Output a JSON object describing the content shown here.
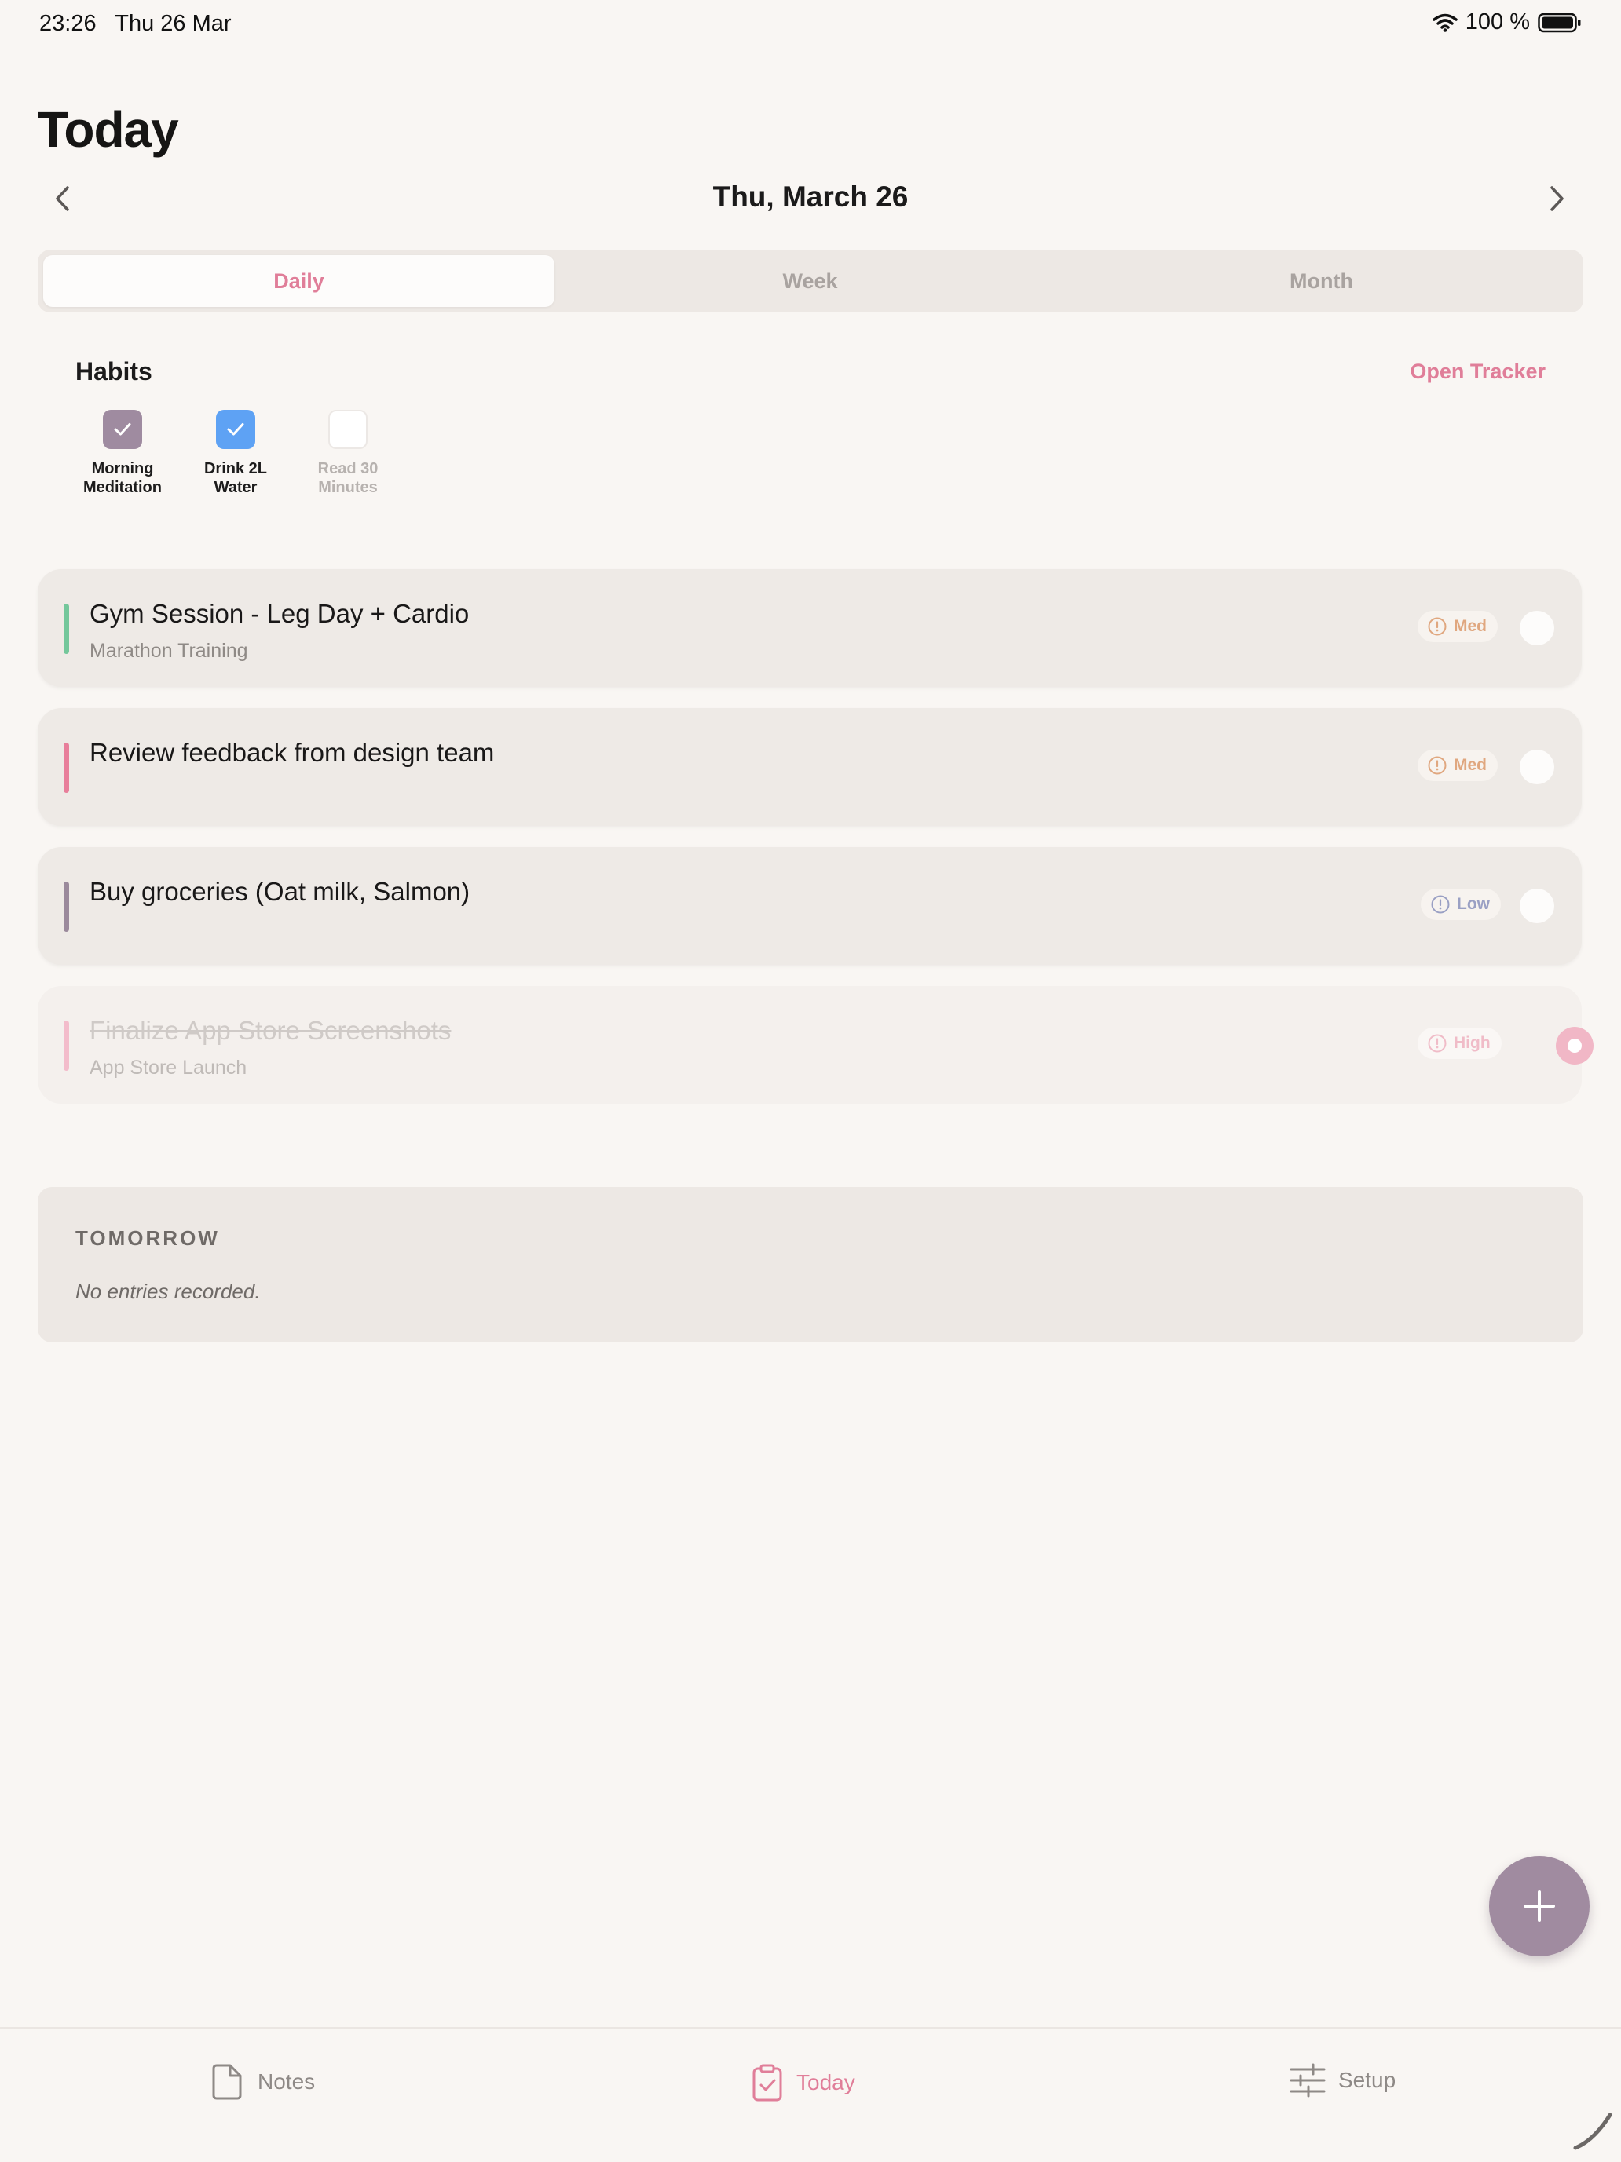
{
  "status_bar": {
    "time": "23:26",
    "date": "Thu 26 Mar",
    "battery": "100 %"
  },
  "page": {
    "title": "Today",
    "date": "Thu, March 26"
  },
  "segments": [
    {
      "label": "Daily",
      "active": true
    },
    {
      "label": "Week",
      "active": false
    },
    {
      "label": "Month",
      "active": false
    }
  ],
  "habits": {
    "title": "Habits",
    "open_tracker": "Open Tracker",
    "items": [
      {
        "line1": "Morning",
        "line2": "Meditation",
        "done": true,
        "color": "#9f8ba0"
      },
      {
        "line1": "Drink 2L",
        "line2": "Water",
        "done": true,
        "color": "#5ea2f4"
      },
      {
        "line1": "Read 30",
        "line2": "Minutes",
        "done": false,
        "color": "#ffffff"
      }
    ]
  },
  "tasks": [
    {
      "title": "Gym Session - Leg Day + Cardio",
      "subtitle": "Marathon Training",
      "priority": "Med",
      "bar_color": "#74c79b",
      "priority_color": "#e0a77f",
      "done": false
    },
    {
      "title": "Review feedback from design team",
      "subtitle": "",
      "priority": "Med",
      "bar_color": "#e87f9b",
      "priority_color": "#e0a77f",
      "done": false
    },
    {
      "title": "Buy groceries (Oat milk, Salmon)",
      "subtitle": "",
      "priority": "Low",
      "bar_color": "#9b8a9c",
      "priority_color": "#9aa0c4",
      "done": false
    },
    {
      "title": "Finalize App Store Screenshots",
      "subtitle": "App Store Launch",
      "priority": "High",
      "bar_color": "#f3bccb",
      "priority_color": "#f0bcc8",
      "done": true
    }
  ],
  "tomorrow": {
    "title": "TOMORROW",
    "empty": "No entries recorded."
  },
  "tabbar": [
    {
      "label": "Notes",
      "icon": "document-icon",
      "active": false
    },
    {
      "label": "Today",
      "icon": "clipboard-check-icon",
      "active": true
    },
    {
      "label": "Setup",
      "icon": "sliders-icon",
      "active": false
    }
  ],
  "colors": {
    "accent": "#e07e99",
    "fab": "#a08ba0",
    "background": "#f9f6f3"
  }
}
